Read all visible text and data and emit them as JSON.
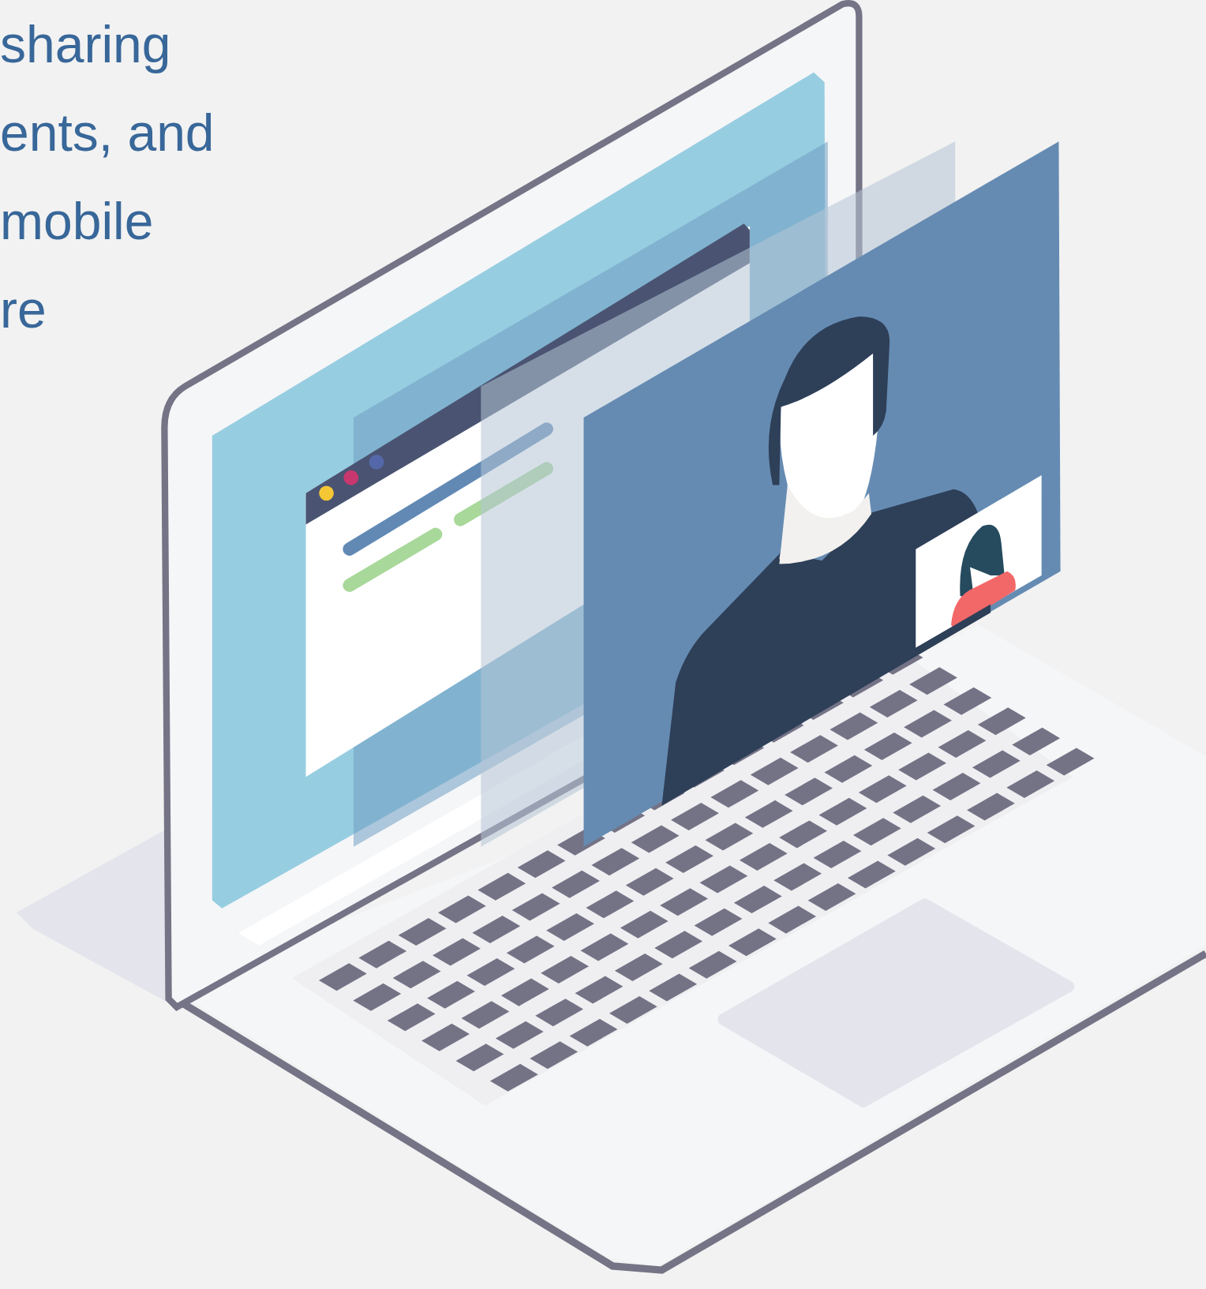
{
  "text_lines": [
    "sharing",
    "ents, and",
    "mobile",
    "re"
  ]
}
